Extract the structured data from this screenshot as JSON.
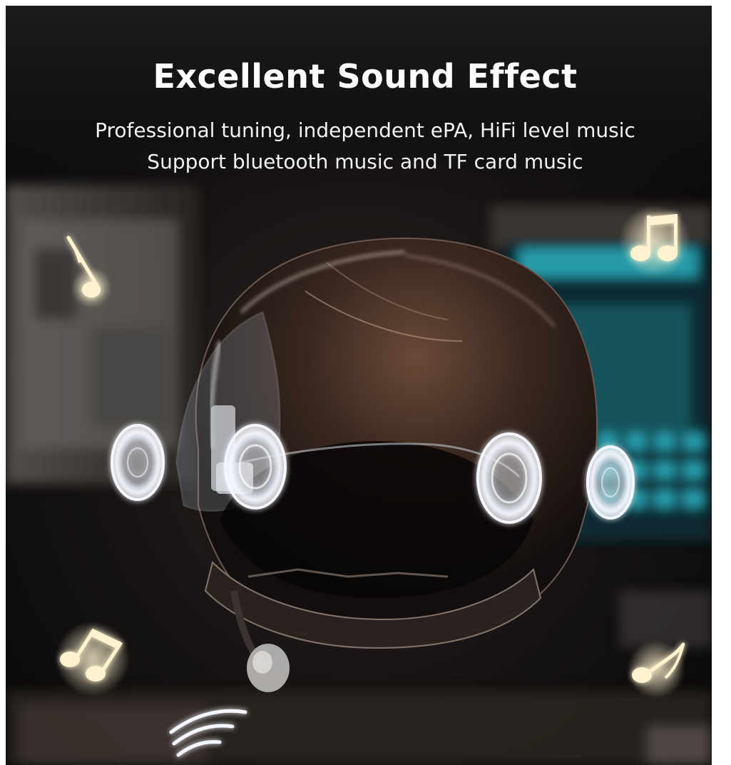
{
  "banner": {
    "title": "Excellent Sound Effect",
    "subtitle_line1": "Professional tuning, independent ePA, HiFi level music",
    "subtitle_line2": "Support bluetooth music and TF card music"
  },
  "illustration": {
    "subject": "helmet-with-speakers",
    "icons": [
      "music-note-icon",
      "beamed-notes-icon",
      "beamed-notes-icon",
      "music-note-icon",
      "wireless-signal-icon"
    ]
  },
  "colors": {
    "background": "#0d0b0b",
    "title_text": "#ffffff",
    "note_glow": "#fff3cf",
    "speaker_glow": "#f4f6ff",
    "screen_cyan": "#2fb9c9"
  }
}
